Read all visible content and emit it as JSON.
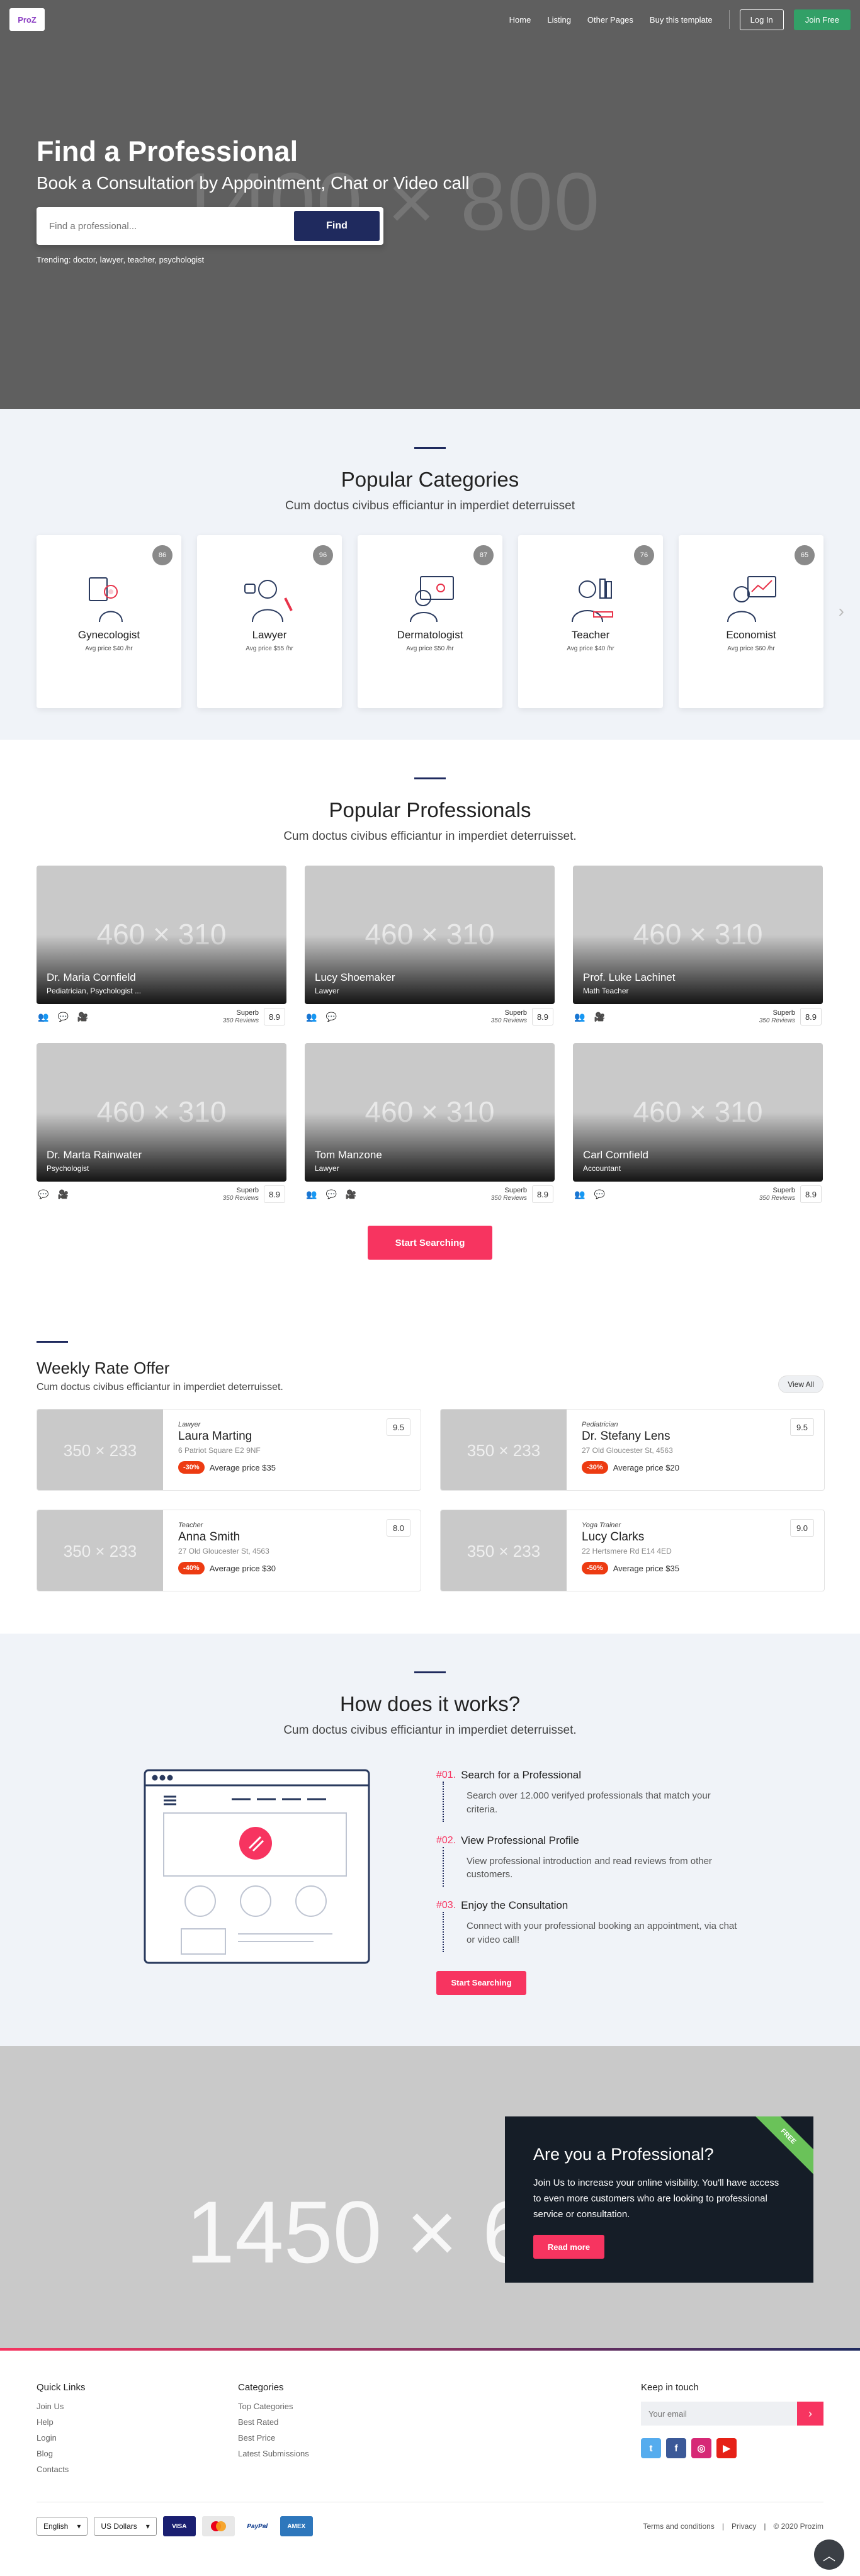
{
  "header": {
    "logo_text": "ProZ",
    "nav": [
      "Home",
      "Listing",
      "Other Pages",
      "Buy this template"
    ],
    "login": "Log In",
    "join": "Join Free"
  },
  "hero": {
    "placeholder_label": "1400 × 800",
    "title": "Find a Professional",
    "subtitle": "Book a Consultation by Appointment, Chat or Video call",
    "search_placeholder": "Find a professional...",
    "search_button": "Find",
    "trending": "Trending: doctor, lawyer, teacher, psychologist"
  },
  "categories": {
    "title": "Popular Categories",
    "subtitle": "Cum doctus civibus efficiantur in imperdiet deterruisset",
    "items": [
      {
        "name": "Gynecologist",
        "price": "Avg price $40 /hr",
        "count": "86",
        "icon": "gynecologist-icon"
      },
      {
        "name": "Lawyer",
        "price": "Avg price $55 /hr",
        "count": "96",
        "icon": "lawyer-icon"
      },
      {
        "name": "Dermatologist",
        "price": "Avg price $50 /hr",
        "count": "87",
        "icon": "dermatologist-icon"
      },
      {
        "name": "Teacher",
        "price": "Avg price $40 /hr",
        "count": "76",
        "icon": "teacher-icon"
      },
      {
        "name": "Economist",
        "price": "Avg price $60 /hr",
        "count": "65",
        "icon": "economist-icon"
      }
    ]
  },
  "professionals": {
    "title": "Popular Professionals",
    "subtitle": "Cum doctus civibus efficiantur in imperdiet deterruisset.",
    "placeholder_label": "460 × 310",
    "rating_label": "Superb",
    "reviews": "350 Reviews",
    "items": [
      {
        "name": "Dr. Maria Cornfield",
        "spec": "Pediatrician, Psychologist ...",
        "score": "8.9"
      },
      {
        "name": "Lucy Shoemaker",
        "spec": "Lawyer",
        "score": "8.9"
      },
      {
        "name": "Prof. Luke Lachinet",
        "spec": "Math Teacher",
        "score": "8.9"
      },
      {
        "name": "Dr. Marta Rainwater",
        "spec": "Psychologist",
        "score": "8.9"
      },
      {
        "name": "Tom Manzone",
        "spec": "Lawyer",
        "score": "8.9"
      },
      {
        "name": "Carl Cornfield",
        "spec": "Accountant",
        "score": "8.9"
      }
    ],
    "button": "Start Searching"
  },
  "weekly": {
    "title": "Weekly Rate Offer",
    "subtitle": "Cum doctus civibus efficiantur in imperdiet deterruisset.",
    "view_all": "View All",
    "placeholder_label": "350 × 233",
    "items": [
      {
        "role": "Lawyer",
        "name": "Laura Marting",
        "addr": "6 Patriot Square E2 9NF",
        "disc": "-30%",
        "price": "Average price $35",
        "score": "9.5"
      },
      {
        "role": "Pediatrician",
        "name": "Dr. Stefany Lens",
        "addr": "27 Old Gloucester St, 4563",
        "disc": "-30%",
        "price": "Average price $20",
        "score": "9.5"
      },
      {
        "role": "Teacher",
        "name": "Anna Smith",
        "addr": "27 Old Gloucester St, 4563",
        "disc": "-40%",
        "price": "Average price $30",
        "score": "8.0"
      },
      {
        "role": "Yoga Trainer",
        "name": "Lucy Clarks",
        "addr": "22 Hertsmere Rd E14 4ED",
        "disc": "-50%",
        "price": "Average price $35",
        "score": "9.0"
      }
    ]
  },
  "how": {
    "title": "How does it works?",
    "subtitle": "Cum doctus civibus efficiantur in imperdiet deterruisset.",
    "steps": [
      {
        "num": "#01.",
        "title": "Search for a Professional",
        "text": "Search over 12.000 verifyed professionals that match your criteria."
      },
      {
        "num": "#02.",
        "title": "View Professional Profile",
        "text": "View professional introduction and read reviews from other customers."
      },
      {
        "num": "#03.",
        "title": "Enjoy the Consultation",
        "text": "Connect with your professional booking an appointment, via chat or video call!"
      }
    ],
    "button": "Start Searching"
  },
  "promo": {
    "placeholder_label": "1450 × 6",
    "title": "Are you a Professional?",
    "text": "Join Us to increase your online visibility. You'll have access to even more customers who are looking to professional service or consultation.",
    "button": "Read more",
    "ribbon": "FREE"
  },
  "footer": {
    "quick_links_title": "Quick Links",
    "quick_links": [
      "Join Us",
      "Help",
      "Login",
      "Blog",
      "Contacts"
    ],
    "categories_title": "Categories",
    "categories": [
      "Top Categories",
      "Best Rated",
      "Best Price",
      "Latest Submissions"
    ],
    "keep_title": "Keep in touch",
    "email_placeholder": "Your email",
    "language": "English",
    "currency": "US Dollars",
    "terms": "Terms and conditions",
    "privacy": "Privacy",
    "copyright": "© 2020 Prozim"
  },
  "colors": {
    "navy": "#1f2a5e",
    "pink": "#f73460",
    "green": "#32a067"
  }
}
